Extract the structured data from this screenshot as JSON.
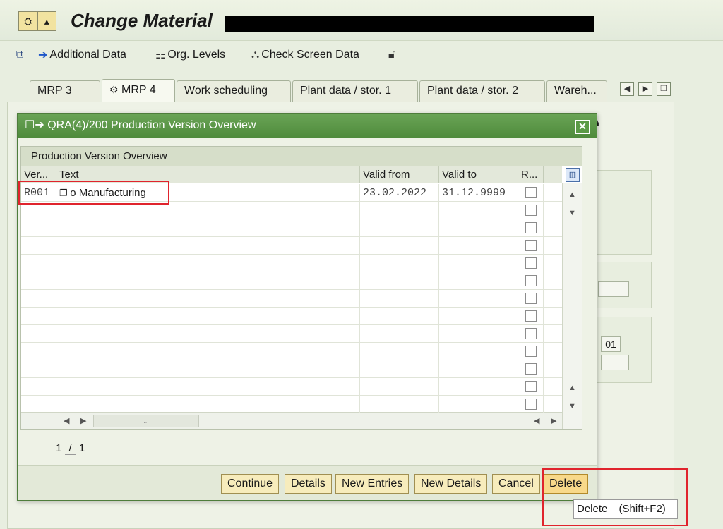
{
  "window": {
    "title": "Change Material"
  },
  "toolbar": {
    "additional_data": "Additional Data",
    "org_levels": "Org. Levels",
    "check_screen_data": "Check Screen Data"
  },
  "tabs": [
    {
      "label": "MRP 3",
      "active": false
    },
    {
      "label": "MRP 4",
      "active": true
    },
    {
      "label": "Work scheduling",
      "active": false
    },
    {
      "label": "Plant data / stor. 1",
      "active": false
    },
    {
      "label": "Plant data / stor. 2",
      "active": false
    },
    {
      "label": "Wareh...",
      "active": false
    }
  ],
  "background": {
    "field_value": "01"
  },
  "dialog": {
    "title": "QRA(4)/200 Production Version Overview",
    "table_caption": "Production Version Overview",
    "columns": {
      "version": "Ver...",
      "text": "Text",
      "valid_from": "Valid from",
      "valid_to": "Valid to",
      "r": "R..."
    },
    "rows": [
      {
        "version": "R001",
        "text": "o Manufacturing",
        "valid_from": "23.02.2022",
        "valid_to": "31.12.9999"
      }
    ],
    "empty_rows": 12,
    "scroll_grip": ":::",
    "page_current": "1",
    "page_separator": "/",
    "page_total": "1",
    "buttons": {
      "continue": "Continue",
      "details": "Details",
      "new_entries": "New Entries",
      "new_details": "New Details",
      "cancel": "Cancel",
      "delete": "Delete"
    }
  },
  "tooltip": {
    "label": "Delete",
    "shortcut": "(Shift+F2)"
  },
  "colors": {
    "dialog_header": "#5a9647",
    "button": "#f7ecbc",
    "button_hover": "#f8d98a",
    "annotation": "#e0242d"
  }
}
